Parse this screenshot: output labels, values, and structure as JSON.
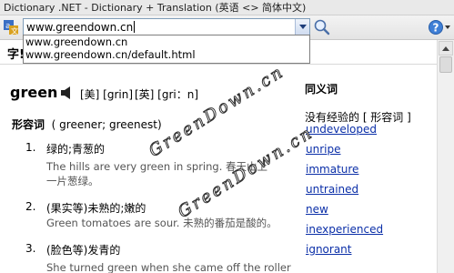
{
  "window": {
    "title": "Dictionary .NET - Dictionary + Translation (英语 <> 简体中文)"
  },
  "toolbar": {
    "search_value": "www.greendown.cn",
    "search_icon": "magnifier-icon",
    "help_icon": "help-icon"
  },
  "dropdown": {
    "items": [
      "www.greendown.cn",
      "www.greendown.cn/default.html"
    ]
  },
  "content": {
    "tab_stub": "字!",
    "headword": "green",
    "phonetic_us": "[美] [grin]",
    "phonetic_uk": "[英] [gri：n]",
    "pos_label": "形容词",
    "pos_forms": "( greener; greenest)",
    "senses": [
      {
        "num": "1.",
        "def": "绿的;青葱的",
        "example": "The hills are very green in spring. 春天山上一片葱绿。"
      },
      {
        "num": "2.",
        "def": "(果实等)未熟的;嫩的",
        "example": "Green tomatoes are sour. 未熟的番茄是酸的。"
      },
      {
        "num": "3.",
        "def": "(脸色等)发青的",
        "example": "She turned green when she came off the roller"
      }
    ]
  },
  "synonyms": {
    "title": "同义词",
    "subtitle": "没有经验的 [ 形容词 ]",
    "items": [
      "undeveloped",
      "unripe",
      "immature",
      "untrained",
      "new",
      "inexperienced",
      "ignorant"
    ]
  },
  "watermark": {
    "text1": "GreenDown.cn",
    "text2": "GreenDown.cn"
  },
  "colors": {
    "link": "#0b2fa8",
    "example_text": "#555555"
  }
}
